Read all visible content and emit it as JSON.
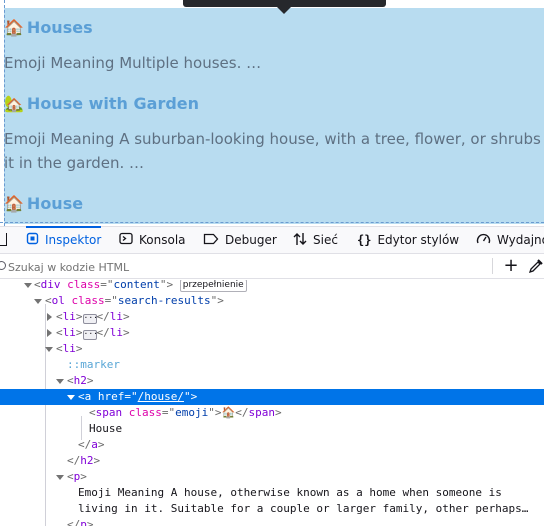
{
  "preview": {
    "results": [
      {
        "emoji": "🏠",
        "title": "Houses",
        "desc": [
          "Emoji Meaning Multiple houses. …"
        ]
      },
      {
        "emoji": "🏡",
        "title": "House with Garden",
        "desc": [
          "Emoji Meaning A suburban-looking house, with a tree, flower, or shrubs around",
          "it in the garden. …"
        ]
      },
      {
        "emoji": "🏠",
        "title": "House",
        "desc": []
      }
    ]
  },
  "toolbar": {
    "tabs": [
      {
        "label": "Inspektor",
        "icon": "inspector-icon"
      },
      {
        "label": "Konsola",
        "icon": "console-icon"
      },
      {
        "label": "Debuger",
        "icon": "debugger-icon"
      },
      {
        "label": "Sieć",
        "icon": "network-icon"
      },
      {
        "label": "Edytor stylów",
        "icon": "style-editor-icon"
      },
      {
        "label": "Wydajno",
        "icon": "performance-icon"
      }
    ]
  },
  "search": {
    "placeholder": "Szukaj w kodzie HTML",
    "value": ""
  },
  "markup": {
    "div_tag": "div",
    "div_class_attr": "class",
    "div_class_val": "content",
    "overflow_badge": "przepełnienie",
    "ol_tag": "ol",
    "ol_class_attr": "class",
    "ol_class_val": "search-results",
    "li_tag": "li",
    "marker": "::marker",
    "h2_tag": "h2",
    "a_tag": "a",
    "a_href_attr": "href",
    "a_href_val": "/house/",
    "span_tag": "span",
    "span_class_attr": "class",
    "span_class_val": "emoji",
    "span_text": "🏠",
    "a_text": "House",
    "p_tag": "p",
    "p_text_1": "Emoji Meaning A house, otherwise known as a home when someone is",
    "p_text_2": "living in it. Suitable for a couple or larger family, other perhaps…"
  },
  "colors": {
    "selection": "#0074e8",
    "highlight": "#b8dcf0",
    "link": "#5b9fd6",
    "active_tab": "#0061e0"
  }
}
